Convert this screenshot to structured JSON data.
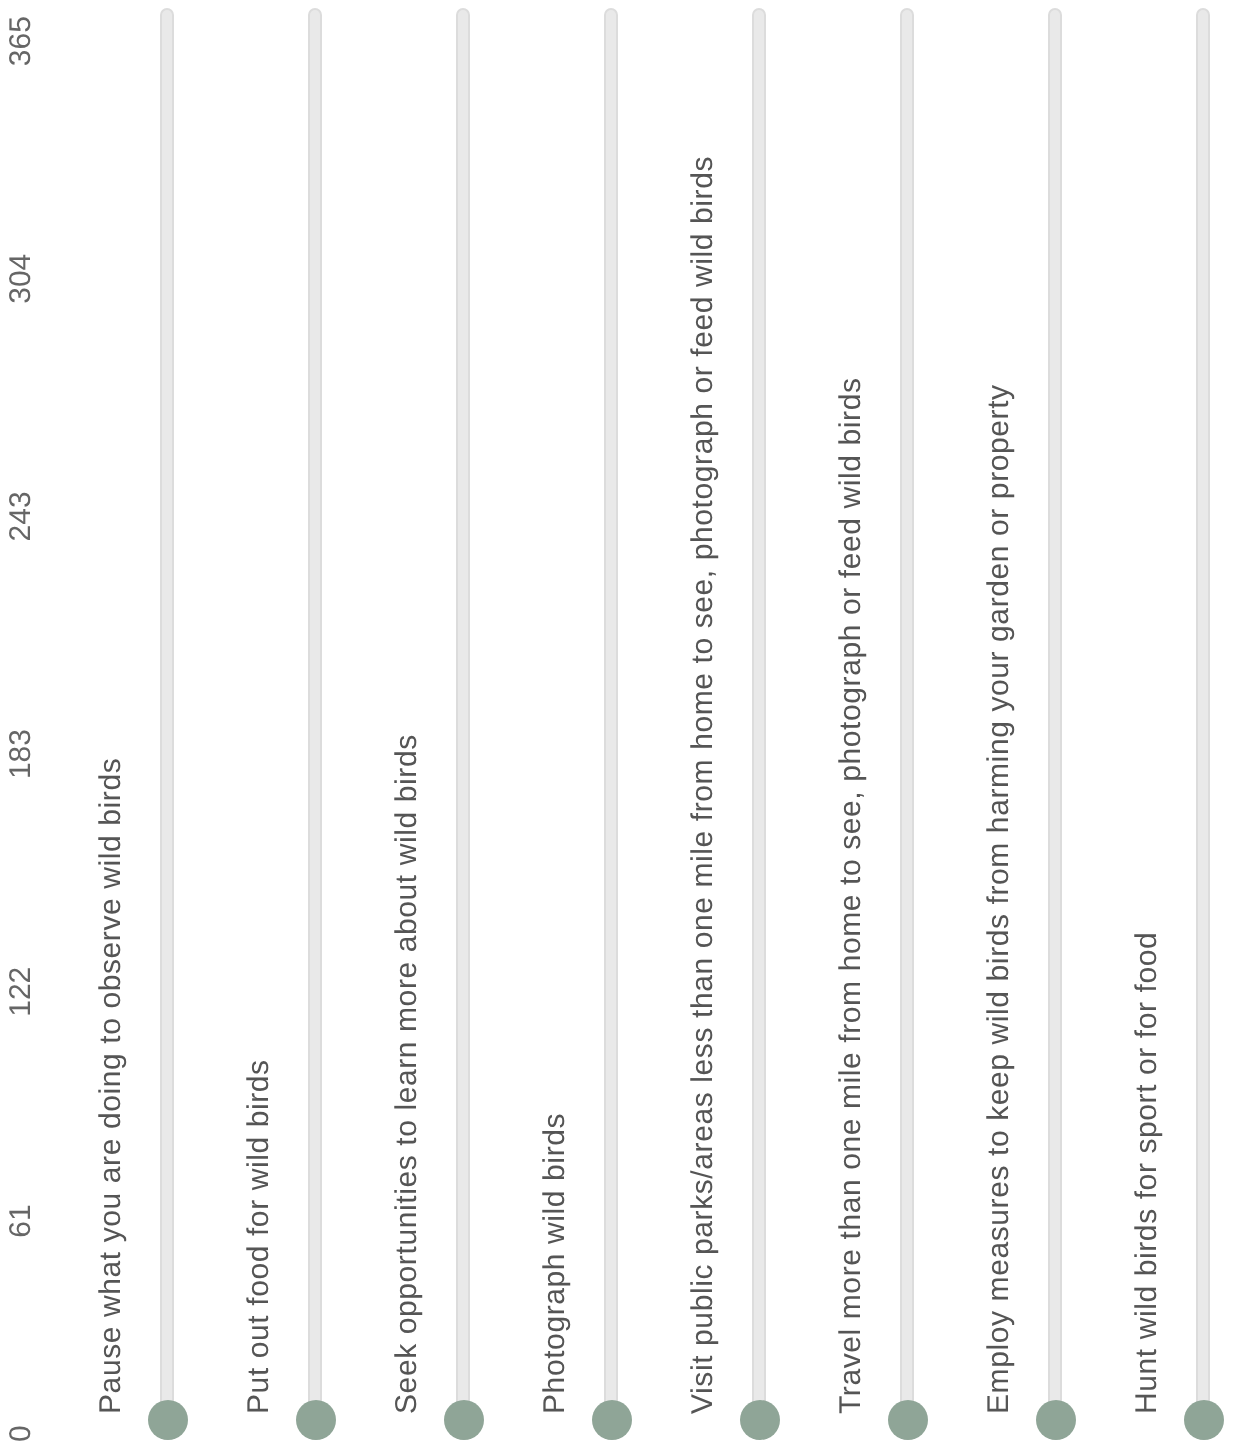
{
  "scale": [
    "0",
    "61",
    "122",
    "183",
    "243",
    "304",
    "365"
  ],
  "questions": [
    {
      "label": "Pause what you are doing to observe wild birds",
      "level": 0
    },
    {
      "label": "Put out food for wild birds",
      "level": 0
    },
    {
      "label": "Seek opportunities to learn more about wild birds",
      "level": 0
    },
    {
      "label": "Photograph wild birds",
      "level": 0
    },
    {
      "label": "Visit public parks/areas less than one mile from home to see, photograph or feed wild birds",
      "level": 0
    },
    {
      "label": "Travel more than one mile from home to see, photograph or feed wild birds",
      "level": 0
    },
    {
      "label": "Employ measures to keep wild birds from harming your garden or property",
      "level": 0
    },
    {
      "label": "Hunt wild birds for sport or for food",
      "level": 0
    }
  ]
}
